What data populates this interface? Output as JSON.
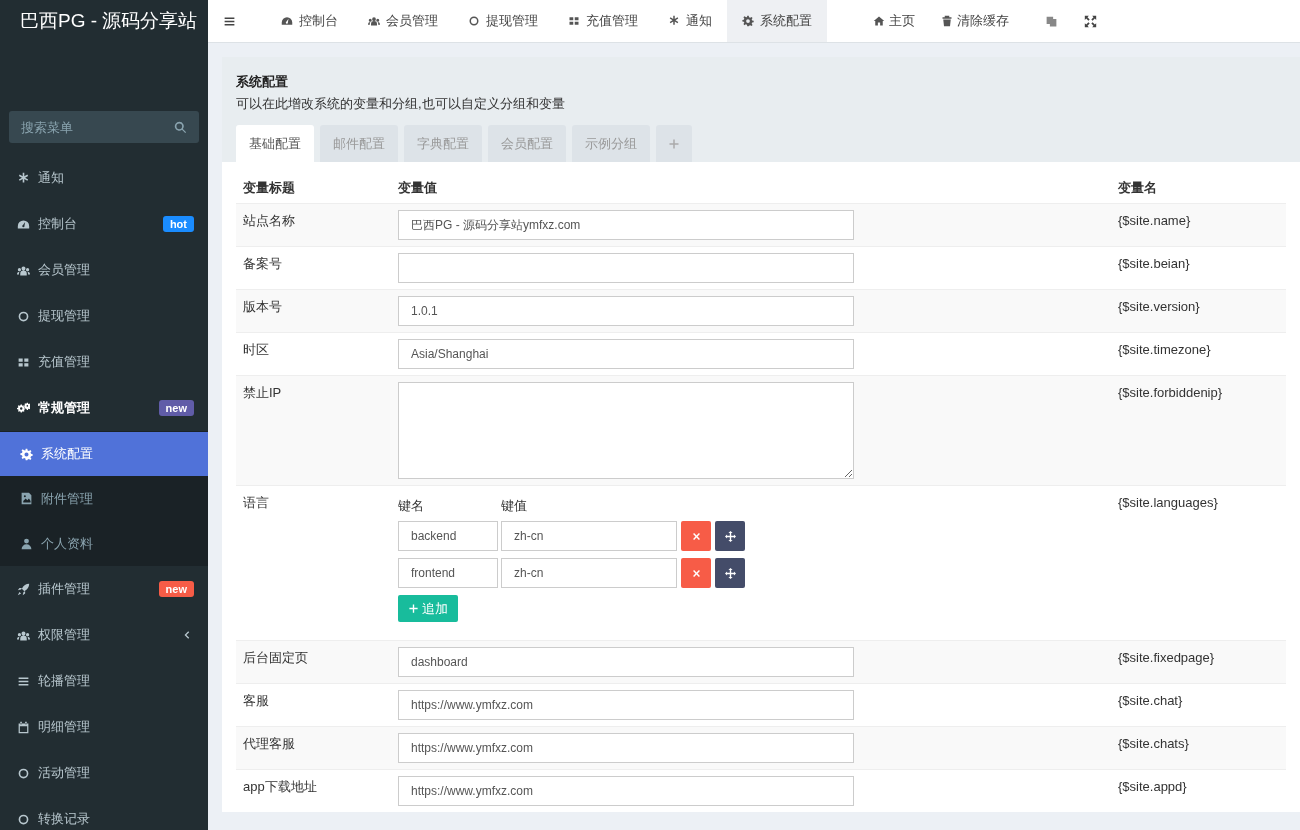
{
  "brand": "巴西PG - 源码分享站",
  "sidebar": {
    "search": {
      "placeholder": "搜索菜单"
    },
    "items": [
      {
        "label": "通知",
        "selected": false
      },
      {
        "label": "控制台",
        "selected": false,
        "badge": {
          "text": "hot",
          "color": "#1a8cff"
        }
      },
      {
        "label": "会员管理",
        "selected": false
      },
      {
        "label": "提现管理",
        "selected": false
      },
      {
        "label": "充值管理",
        "selected": false
      },
      {
        "label": "常规管理",
        "selected": false,
        "expanded": true,
        "badge": {
          "text": "new",
          "color": "#605ca8"
        },
        "children": [
          {
            "label": "系统配置",
            "selected": true
          },
          {
            "label": "附件管理",
            "selected": false
          },
          {
            "label": "个人资料",
            "selected": false
          }
        ]
      },
      {
        "label": "插件管理",
        "selected": false,
        "badge": {
          "text": "new",
          "color": "#f75c47"
        }
      },
      {
        "label": "权限管理",
        "selected": false,
        "expanded": false
      },
      {
        "label": "轮播管理",
        "selected": false
      },
      {
        "label": "明细管理",
        "selected": false
      },
      {
        "label": "活动管理",
        "selected": false
      },
      {
        "label": "转换记录",
        "selected": false
      }
    ]
  },
  "nav": {
    "tabs": [
      {
        "label": "控制台",
        "selected": false
      },
      {
        "label": "会员管理",
        "selected": false
      },
      {
        "label": "提现管理",
        "selected": false
      },
      {
        "label": "充值管理",
        "selected": false
      },
      {
        "label": "通知",
        "selected": false
      },
      {
        "label": "系统配置",
        "selected": true
      }
    ],
    "links": [
      "主页",
      "清除缓存"
    ]
  },
  "panel": {
    "title": "系统配置",
    "description": "可以在此增改系统的变量和分组,也可以自定义分组和变量",
    "tabs": [
      {
        "label": "基础配置",
        "selected": true
      },
      {
        "label": "邮件配置",
        "selected": false
      },
      {
        "label": "字典配置",
        "selected": false
      },
      {
        "label": "会员配置",
        "selected": false
      },
      {
        "label": "示例分组",
        "selected": false
      }
    ],
    "table": {
      "columns": [
        "变量标题",
        "变量值",
        "变量名"
      ],
      "rows": [
        {
          "kind": "text",
          "title": "站点名称",
          "value": "巴西PG - 源码分享站ymfxz.com",
          "variable": "{$site.name}"
        },
        {
          "kind": "text",
          "title": "备案号",
          "variable": "{$site.beian}"
        },
        {
          "kind": "text",
          "title": "版本号",
          "value": "1.0.1",
          "variable": "{$site.version}"
        },
        {
          "kind": "text",
          "title": "时区",
          "value": "Asia/Shanghai",
          "variable": "{$site.timezone}"
        },
        {
          "kind": "textarea",
          "title": "禁止IP",
          "variable": "{$site.forbiddenip}"
        },
        {
          "kind": "keyvalue",
          "title": "语言",
          "key_label": "键名",
          "value_label": "键值",
          "pairs": [
            {
              "key": "backend",
              "value": "zh-cn"
            },
            {
              "key": "frontend",
              "value": "zh-cn"
            }
          ],
          "add_button": "追加",
          "variable": "{$site.languages}"
        },
        {
          "kind": "text",
          "title": "后台固定页",
          "value": "dashboard",
          "variable": "{$site.fixedpage}"
        },
        {
          "kind": "text",
          "title": "客服",
          "value": "https://www.ymfxz.com",
          "variable": "{$site.chat}"
        },
        {
          "kind": "text",
          "title": "代理客服",
          "value": "https://www.ymfxz.com",
          "variable": "{$site.chats}"
        },
        {
          "kind": "text",
          "title": "app下载地址",
          "value": "https://www.ymfxz.com",
          "variable": "{$site.appd}"
        }
      ]
    }
  }
}
